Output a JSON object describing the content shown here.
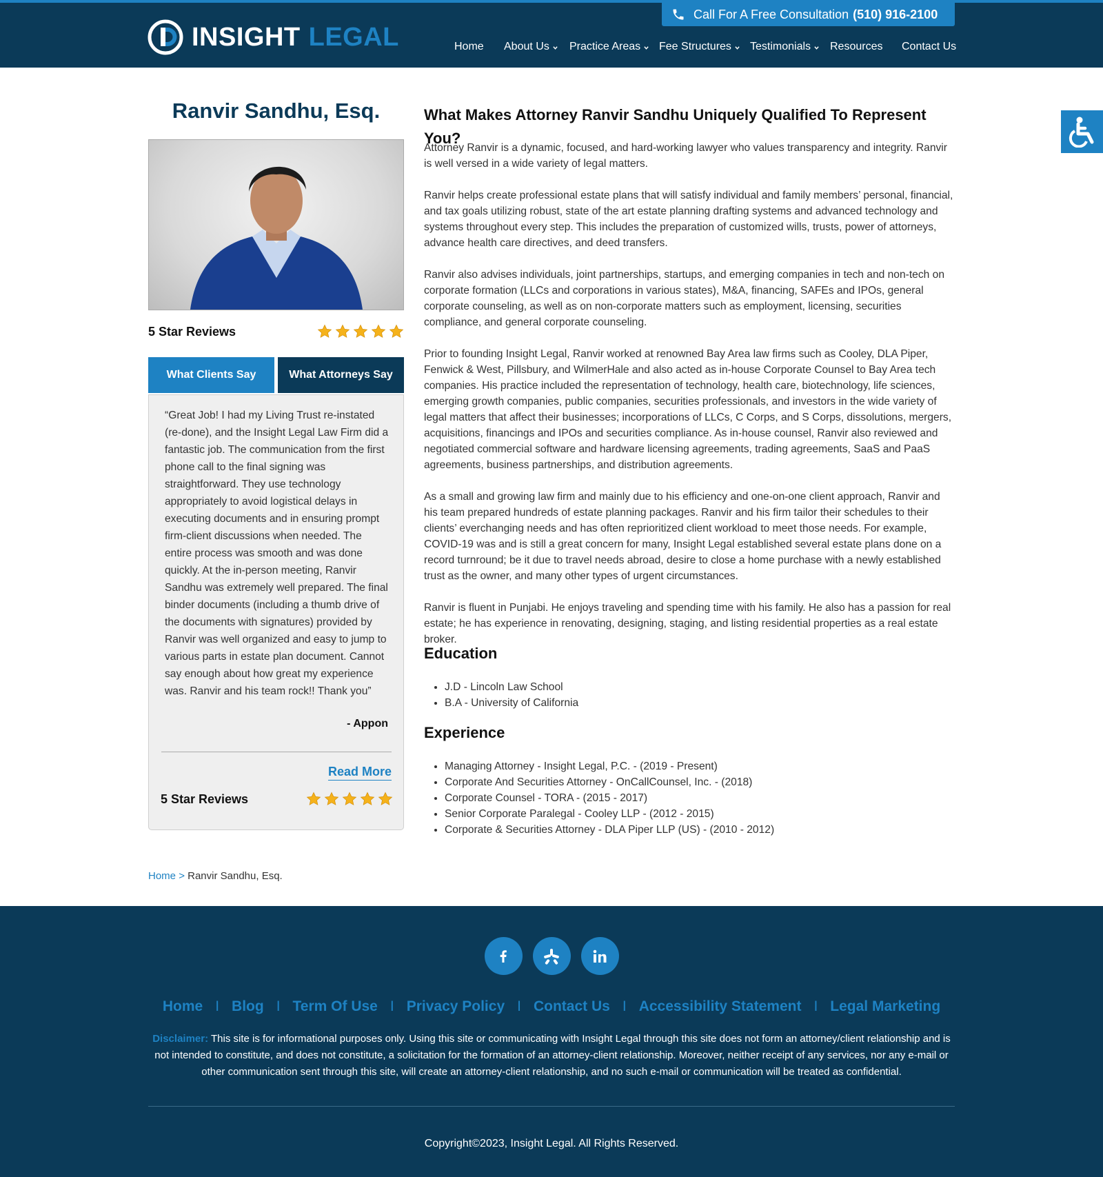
{
  "header": {
    "consult_label": "Call For A Free Consultation",
    "consult_phone": "(510) 916-2100",
    "logo_word1": "INSIGHT",
    "logo_word2": "LEGAL",
    "nav": [
      {
        "label": "Home",
        "dropdown": false
      },
      {
        "label": "About Us",
        "dropdown": true
      },
      {
        "label": "Practice Areas",
        "dropdown": true
      },
      {
        "label": "Fee Structures",
        "dropdown": true
      },
      {
        "label": "Testimonials",
        "dropdown": true
      },
      {
        "label": "Resources",
        "dropdown": false
      },
      {
        "label": "Contact Us",
        "dropdown": false
      }
    ]
  },
  "sidebar": {
    "attorney_name": "Ranvir Sandhu, Esq.",
    "reviews_label": "5 Star Reviews",
    "star_count": 5,
    "tabs": [
      {
        "label": "What Clients Say",
        "active": true
      },
      {
        "label": "What Attorneys Say",
        "active": false
      }
    ],
    "testimonial": {
      "quote": "“Great Job! I had my Living Trust re-instated (re-done), and the Insight Legal Law Firm did a fantastic job. The communication from the first phone call to the final signing was straightforward. They use technology appropriately to avoid logistical delays in executing documents and in ensuring prompt firm-client discussions when needed. The entire process was smooth and was done quickly. At the in-person meeting, Ranvir Sandhu was extremely well prepared. The final binder documents (including a thumb drive of the documents with signatures) provided by Ranvir was well organized and easy to jump to various parts in estate plan document. Cannot say enough about how great my experience was. Ranvir and his team rock!! Thank you”",
      "author": "- Appon",
      "read_more": "Read More",
      "reviews_label": "5 Star Reviews"
    }
  },
  "main": {
    "heading": "What Makes Attorney Ranvir Sandhu Uniquely Qualified To Represent You?",
    "paragraphs": [
      "Attorney Ranvir is a dynamic, focused, and hard-working lawyer who values transparency and integrity. Ranvir is well versed in a wide variety of legal matters.",
      "Ranvir helps create professional estate plans that will satisfy individual and family members’ personal, financial, and tax goals utilizing robust, state of the art estate planning drafting systems and advanced technology and systems throughout every step. This includes the preparation of customized wills, trusts, power of attorneys, advance health care directives, and deed transfers.",
      "Ranvir also advises individuals, joint partnerships, startups, and emerging companies in tech and non-tech on corporate formation (LLCs and corporations in various states), M&A, financing, SAFEs and IPOs, general corporate counseling, as well as on non-corporate matters such as employment, licensing, securities compliance, and general corporate counseling.",
      "Prior to founding Insight Legal, Ranvir worked at renowned Bay Area law firms such as Cooley, DLA Piper, Fenwick & West, Pillsbury, and WilmerHale and also acted as in-house Corporate Counsel to Bay Area tech companies. His practice included the representation of technology, health care, biotechnology, life sciences, emerging growth companies, public companies, securities professionals, and investors in the wide variety of legal matters that affect their businesses; incorporations of LLCs, C Corps, and S Corps, dissolutions, mergers, acquisitions, financings and IPOs and securities compliance. As in-house counsel, Ranvir also reviewed and negotiated commercial software and hardware licensing agreements, trading agreements, SaaS and PaaS agreements, business partnerships, and distribution agreements.",
      "As a small and growing law firm and mainly due to his efficiency and one-on-one client approach, Ranvir and his team prepared hundreds of estate planning packages. Ranvir and his firm tailor their schedules to their clients’ everchanging needs and has often reprioritized client workload to meet those needs. For example, COVID-19 was and is still a great concern for many, Insight Legal established several estate plans done on a record turnround; be it due to travel needs abroad, desire to close a home purchase with a newly established trust as the owner, and many other types of urgent circumstances.",
      "Ranvir is fluent in Punjabi. He enjoys traveling and spending time with his family. He also has a passion for real estate; he has experience in renovating, designing, staging, and listing residential properties as a real estate broker."
    ],
    "education_heading": "Education",
    "education": [
      "J.D - Lincoln Law School",
      "B.A - University of California"
    ],
    "experience_heading": "Experience",
    "experience": [
      "Managing Attorney - Insight Legal, P.C. - (2019 - Present)",
      "Corporate And Securities Attorney - OnCallCounsel, Inc. - (2018)",
      "Corporate Counsel - TORA - (2015 - 2017)",
      "Senior Corporate Paralegal - Cooley LLP - (2012 - 2015)",
      "Corporate & Securities Attorney - DLA Piper LLP (US) - (2010 - 2012)"
    ]
  },
  "breadcrumb": {
    "home": "Home",
    "separator": ">",
    "current": "Ranvir Sandhu, Esq."
  },
  "footer": {
    "social": [
      "facebook-icon",
      "yelp-icon",
      "linkedin-icon"
    ],
    "links": [
      "Home",
      "Blog",
      "Term Of Use",
      "Privacy Policy",
      "Contact Us",
      "Accessibility Statement",
      "Legal Marketing"
    ],
    "link_separator": "I",
    "disclaimer_label": "Disclaimer:",
    "disclaimer_text": "This site is for informational purposes only. Using this site or communicating with Insight Legal through this site does not form an attorney/client relationship and is not intended to constitute, and does not constitute, a solicitation for the formation of an attorney-client relationship. Moreover, neither receipt of any services, nor any e-mail or other communication sent through this site, will create an attorney-client relationship, and no such e-mail or communication will be treated as confidential.",
    "copyright": "Copyright©2023, Insight Legal. All Rights Reserved."
  },
  "colors": {
    "navy": "#0b3a58",
    "accent_blue": "#1e82c3",
    "star_gold": "#f5b21b"
  }
}
